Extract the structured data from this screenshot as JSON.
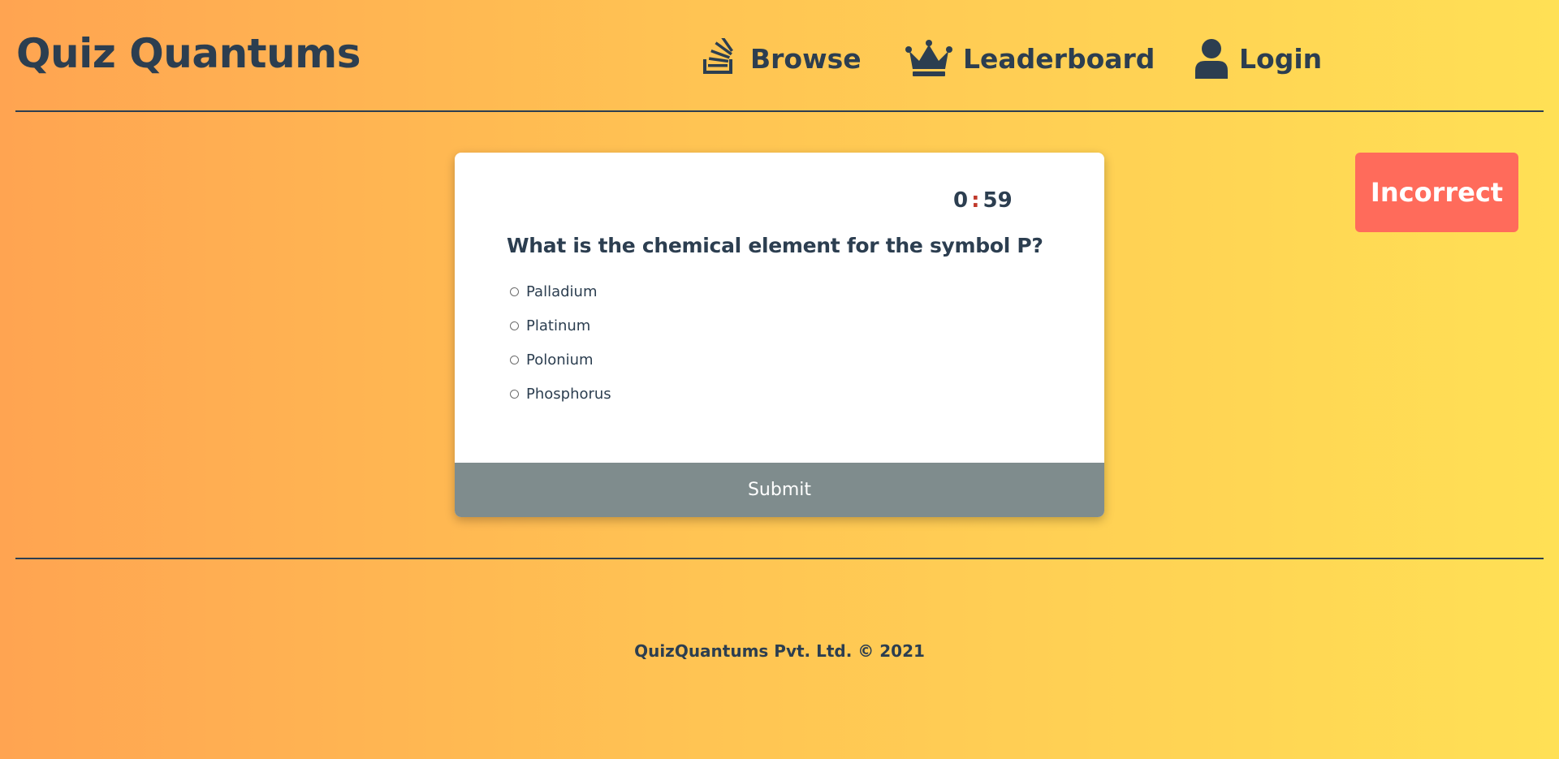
{
  "header": {
    "brand": "Quiz Quantums",
    "nav": [
      {
        "label": "Browse",
        "icon": "stack-icon"
      },
      {
        "label": "Leaderboard",
        "icon": "crown-icon"
      },
      {
        "label": "Login",
        "icon": "user-icon"
      }
    ]
  },
  "quiz": {
    "timer": {
      "minutes": "0",
      "separator": ":",
      "seconds": "59"
    },
    "question": "What is the chemical element for the symbol P?",
    "options": [
      "Palladium",
      "Platinum",
      "Polonium",
      "Phosphorus"
    ],
    "submit_label": "Submit"
  },
  "feedback": {
    "label": "Incorrect",
    "color": "#ff6b5b"
  },
  "footer": {
    "text": "QuizQuantums Pvt. Ltd. © 2021"
  },
  "colors": {
    "text": "#2c3e50",
    "submit_bg": "#7f8c8d",
    "gradient_start": "#ffa451",
    "gradient_end": "#ffe055"
  }
}
